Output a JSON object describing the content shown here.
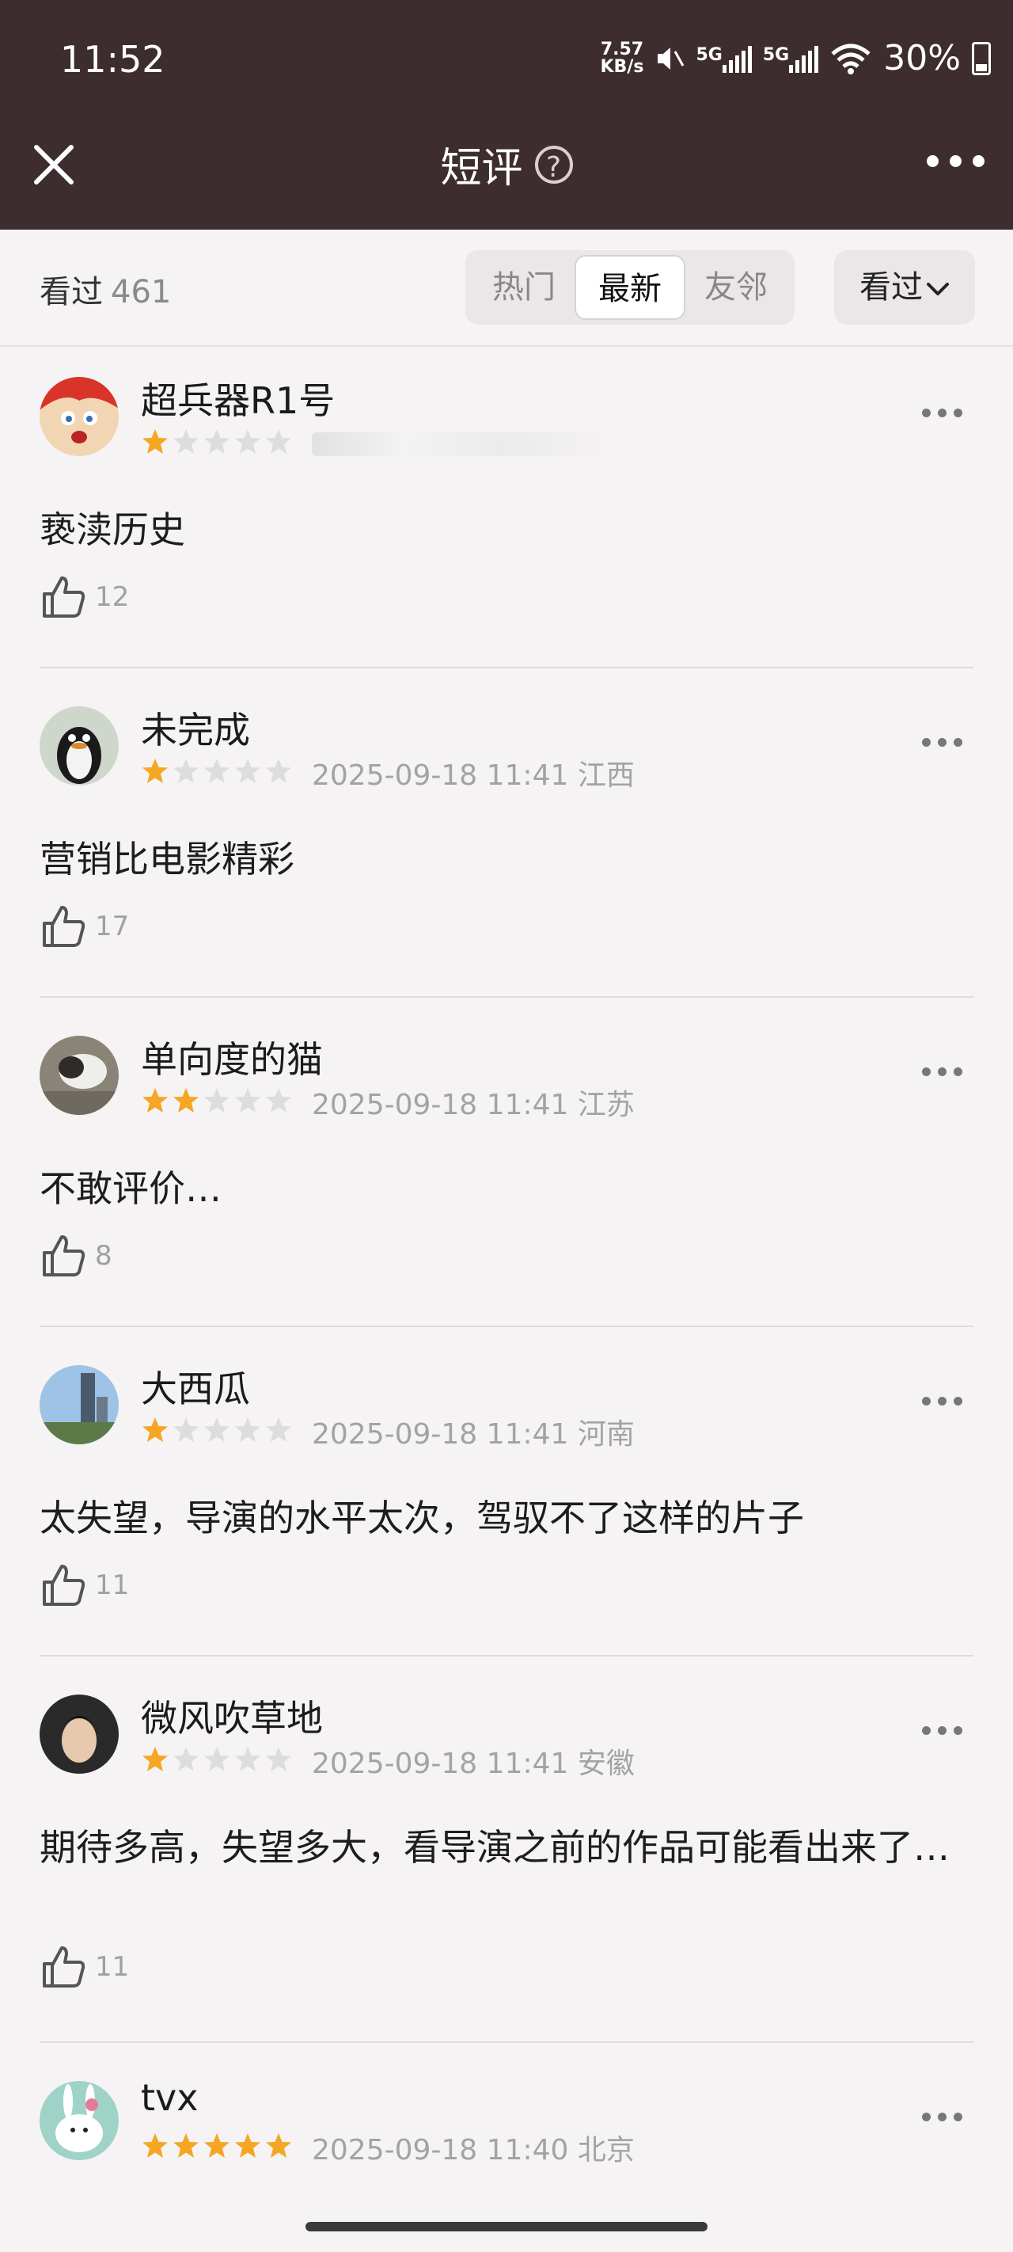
{
  "status_bar": {
    "time": "11:52",
    "net_speed_value": "7.57",
    "net_speed_unit": "KB/s",
    "sim1_label": "5G",
    "sim2_label": "5G",
    "battery": "30%"
  },
  "header": {
    "title": "短评",
    "help_glyph": "?"
  },
  "filter": {
    "count_label": "看过",
    "count_value": "461",
    "tabs": [
      {
        "label": "热门",
        "active": false
      },
      {
        "label": "最新",
        "active": true
      },
      {
        "label": "友邻",
        "active": false
      }
    ],
    "dropdown_label": "看过"
  },
  "colors": {
    "header_bg": "#3d2d2e",
    "page_bg": "#f6f3f4",
    "star_on": "#f5a623",
    "star_off": "#dddddd"
  },
  "reviews": [
    {
      "user": "超兵器R1号",
      "rating": 1,
      "meta": "",
      "content": "亵渎历史",
      "likes": "12"
    },
    {
      "user": "未完成",
      "rating": 1,
      "meta": "2025-09-18 11:41 江西",
      "content": "营销比电影精彩",
      "likes": "17"
    },
    {
      "user": "单向度的猫",
      "rating": 2,
      "meta": "2025-09-18 11:41 江苏",
      "content": "不敢评价…",
      "likes": "8"
    },
    {
      "user": "大西瓜",
      "rating": 1,
      "meta": "2025-09-18 11:41 河南",
      "content": "太失望，导演的水平太次，驾驭不了这样的片子",
      "likes": "11"
    },
    {
      "user": "微风吹草地",
      "rating": 1,
      "meta": "2025-09-18 11:41 安徽",
      "content": "期待多高，失望多大，看导演之前的作品可能看出来了…",
      "likes": "11"
    },
    {
      "user": "tvx",
      "rating": 5,
      "meta": "2025-09-18 11:40 北京",
      "content": "",
      "likes": ""
    }
  ]
}
